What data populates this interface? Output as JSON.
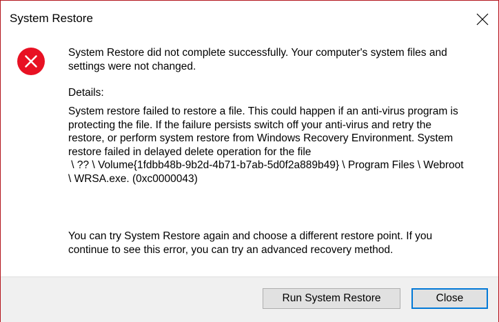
{
  "window": {
    "title": "System Restore",
    "border_color": "#b3141b"
  },
  "title_bar": {
    "close_icon": "close-icon"
  },
  "message": {
    "icon": "error-icon",
    "icon_color": "#e81123",
    "line1": "System Restore did not complete successfully. Your computer's system files and",
    "line2": "settings were not changed."
  },
  "details": {
    "label": "Details:",
    "lines": [
      "System restore failed to restore a file. This could happen if an anti-virus program is",
      "protecting the file. If the failure persists switch off your anti-virus and retry the",
      "restore, or perform system restore from Windows Recovery Environment. System",
      "restore failed in delayed delete operation for the file",
      " \\ ?? \\ Volume{1fdbb48b-9b2d-4b71-b7ab-5d0f2a889b49} \\ Program Files \\ Webroot",
      "\\ WRSA.exe. (0xc0000043)"
    ]
  },
  "footer": {
    "line1": "You can try System Restore again and choose a different restore point. If you",
    "line2": "continue to see this error, you can try an advanced recovery method."
  },
  "buttons": {
    "run_label": "Run System Restore",
    "close_label": "Close",
    "focus_color": "#0078d7"
  }
}
